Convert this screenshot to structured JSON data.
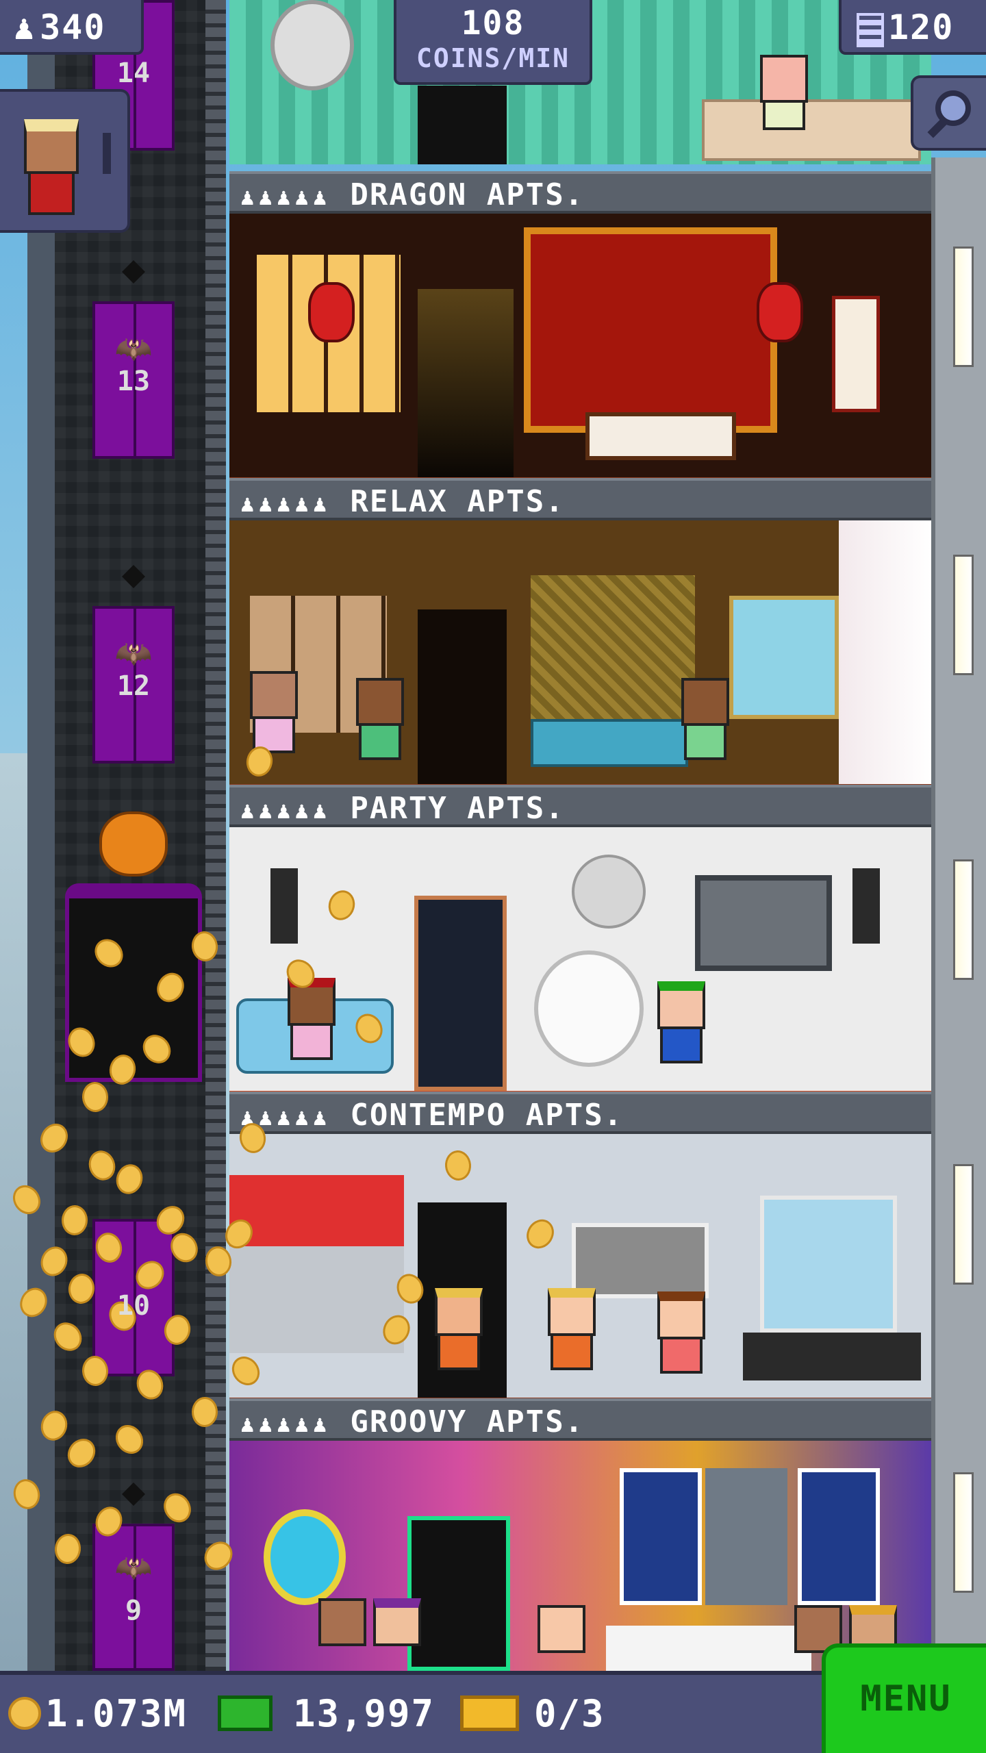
{
  "hud": {
    "population": "340",
    "coins_per_min_value": "108",
    "coins_per_min_label": "COINS/MIN",
    "floors": "120"
  },
  "elevator": {
    "floor_numbers": [
      "14",
      "13",
      "12",
      "10",
      "9"
    ]
  },
  "floors": [
    {
      "name": "DRAGON APTS.",
      "residents": "♟♟♟♟♟"
    },
    {
      "name": "RELAX APTS.",
      "residents": "♟♟♟♟♟"
    },
    {
      "name": "PARTY APTS.",
      "residents": "♟♟♟♟♟"
    },
    {
      "name": "CONTEMPO APTS.",
      "residents": "♟♟♟♟♟"
    },
    {
      "name": "GROOVY APTS.",
      "residents": "♟♟♟♟♟"
    }
  ],
  "bottom_bar": {
    "coins": "1.073M",
    "bux": "13,997",
    "tickets": "0/3",
    "menu_label": "MENU"
  },
  "icons": {
    "population": "person-icon",
    "floors": "building-icon",
    "search": "magnifier-icon",
    "coins": "coin-icon",
    "bux": "cash-icon",
    "tickets": "ticket-icon"
  },
  "colors": {
    "hud_bg": "#4b4f78",
    "menu_green": "#1dc91d",
    "elevator_purple": "#7c0f9c",
    "coin_gold": "#f2c14e"
  }
}
